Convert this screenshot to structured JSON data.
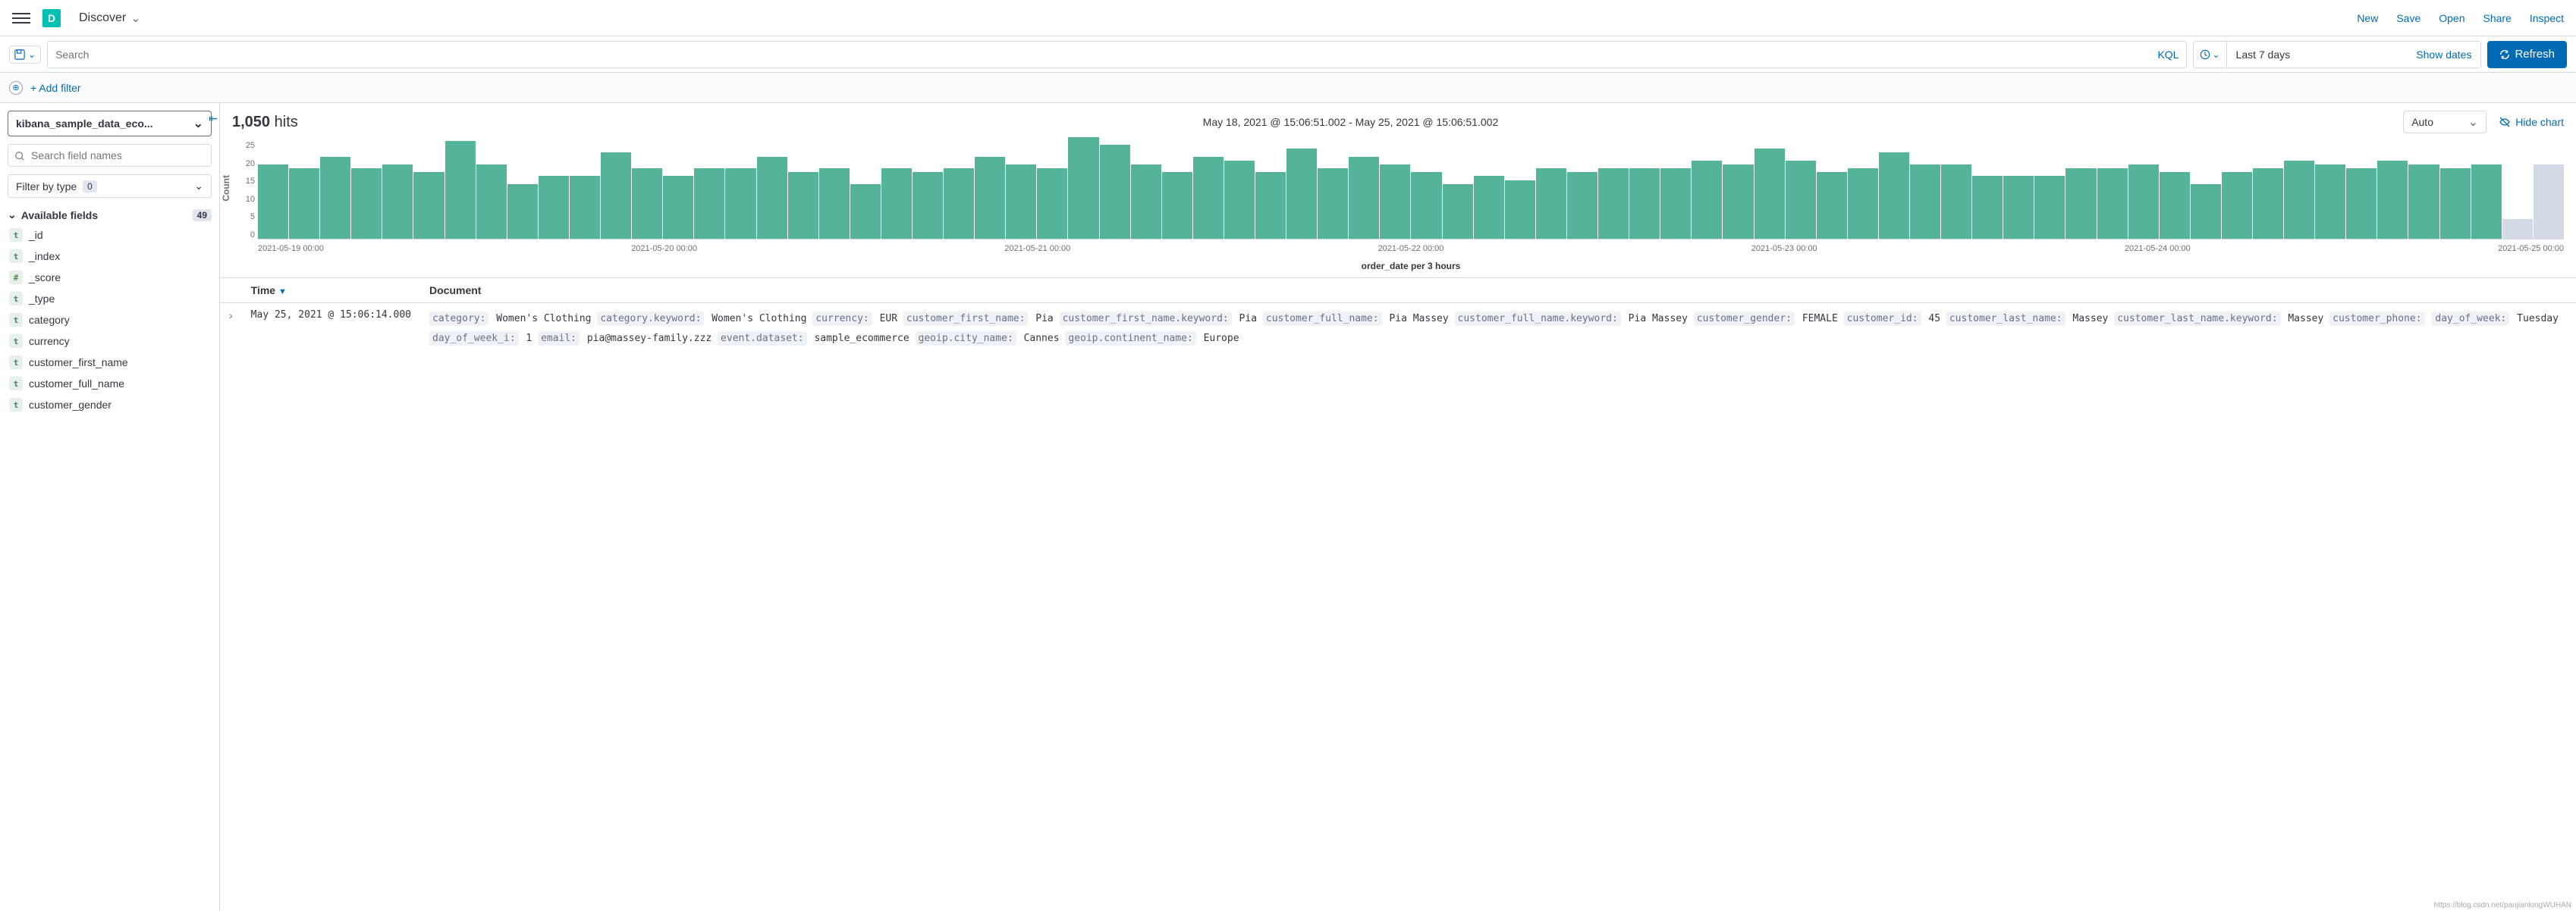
{
  "header": {
    "app_badge": "D",
    "app_title": "Discover",
    "links": {
      "new": "New",
      "save": "Save",
      "open": "Open",
      "share": "Share",
      "inspect": "Inspect"
    }
  },
  "query": {
    "search_placeholder": "Search",
    "kql": "KQL",
    "time_range": "Last 7 days",
    "show_dates": "Show dates",
    "refresh": "Refresh"
  },
  "filters": {
    "add_filter": "+ Add filter"
  },
  "sidebar": {
    "index_pattern": "kibana_sample_data_eco...",
    "field_search_placeholder": "Search field names",
    "filter_by_type": "Filter by type",
    "filter_type_count": "0",
    "available_fields_label": "Available fields",
    "available_fields_count": "49",
    "fields": [
      {
        "token": "t",
        "name": "_id"
      },
      {
        "token": "t",
        "name": "_index"
      },
      {
        "token": "#",
        "name": "_score"
      },
      {
        "token": "t",
        "name": "_type"
      },
      {
        "token": "t",
        "name": "category"
      },
      {
        "token": "t",
        "name": "currency"
      },
      {
        "token": "t",
        "name": "customer_first_name"
      },
      {
        "token": "t",
        "name": "customer_full_name"
      },
      {
        "token": "t",
        "name": "customer_gender"
      }
    ]
  },
  "hits": {
    "count": "1,050",
    "label": "hits",
    "range": "May 18, 2021 @ 15:06:51.002 - May 25, 2021 @ 15:06:51.002",
    "interval": "Auto",
    "hide_chart": "Hide chart"
  },
  "chart_data": {
    "type": "bar",
    "ylabel": "Count",
    "xlabel": "order_date per 3 hours",
    "ylim": [
      0,
      25
    ],
    "y_ticks": [
      "25",
      "20",
      "15",
      "10",
      "5",
      "0"
    ],
    "x_ticks": [
      "2021-05-19 00:00",
      "2021-05-20 00:00",
      "2021-05-21 00:00",
      "2021-05-22 00:00",
      "2021-05-23 00:00",
      "2021-05-24 00:00",
      "2021-05-25 00:00"
    ],
    "values": [
      19,
      18,
      21,
      18,
      19,
      17,
      25,
      19,
      14,
      16,
      16,
      22,
      18,
      16,
      18,
      18,
      21,
      17,
      18,
      14,
      18,
      17,
      18,
      21,
      19,
      18,
      26,
      24,
      19,
      17,
      21,
      20,
      17,
      23,
      18,
      21,
      19,
      17,
      14,
      16,
      15,
      18,
      17,
      18,
      18,
      18,
      20,
      19,
      23,
      20,
      17,
      18,
      22,
      19,
      19,
      16,
      16,
      16,
      18,
      18,
      19,
      17,
      14,
      17,
      18,
      20,
      19,
      18,
      20,
      19,
      18,
      19
    ],
    "partial": [
      5,
      19
    ]
  },
  "table": {
    "col_time": "Time",
    "col_doc": "Document",
    "row_time": "May 25, 2021 @ 15:06:14.000",
    "doc_fields": [
      [
        "category:",
        "Women's Clothing"
      ],
      [
        "category.keyword:",
        "Women's Clothing"
      ],
      [
        "currency:",
        "EUR"
      ],
      [
        "customer_first_name:",
        "Pia"
      ],
      [
        "customer_first_name.keyword:",
        "Pia"
      ],
      [
        "customer_full_name:",
        "Pia Massey"
      ],
      [
        "customer_full_name.keyword:",
        "Pia Massey"
      ],
      [
        "customer_gender:",
        "FEMALE"
      ],
      [
        "customer_id:",
        "45"
      ],
      [
        "customer_last_name:",
        "Massey"
      ],
      [
        "customer_last_name.keyword:",
        "Massey"
      ],
      [
        "customer_phone:",
        ""
      ],
      [
        "day_of_week:",
        "Tuesday"
      ],
      [
        "day_of_week_i:",
        "1"
      ],
      [
        "email:",
        "pia@massey-family.zzz"
      ],
      [
        "event.dataset:",
        "sample_ecommerce"
      ],
      [
        "geoip.city_name:",
        "Cannes"
      ],
      [
        "geoip.continent_name:",
        "Europe"
      ]
    ]
  },
  "watermark": "https://blog.csdn.net/panjianlongWUHAN"
}
